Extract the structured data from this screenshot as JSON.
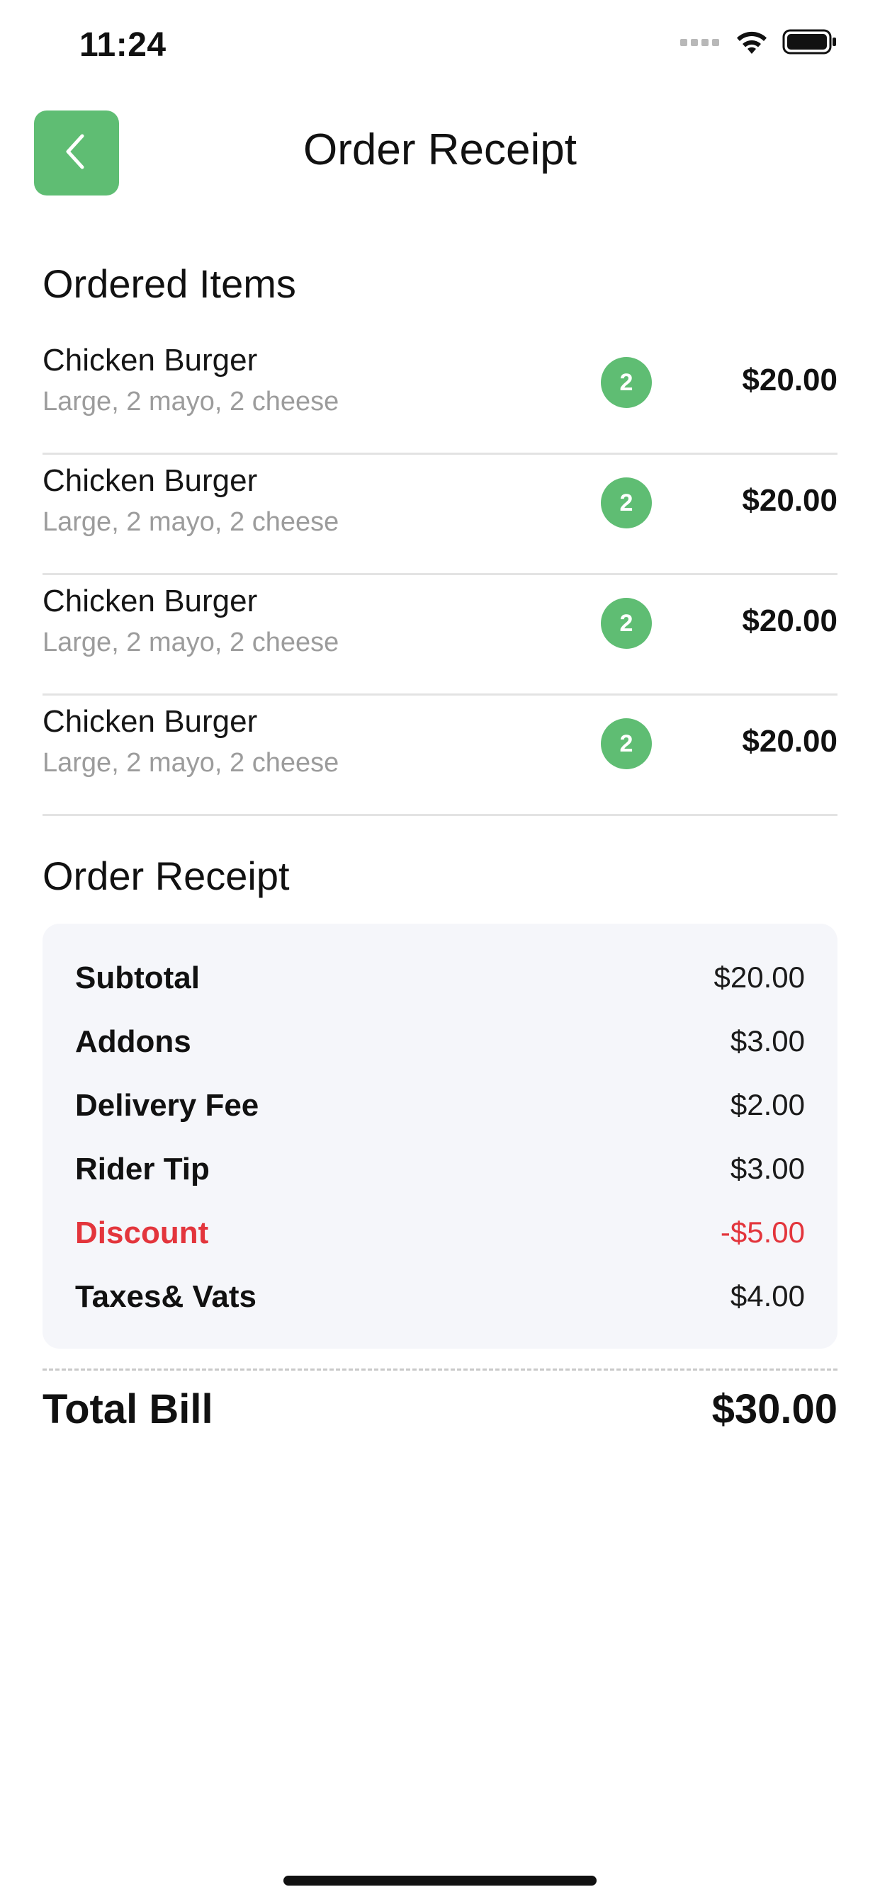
{
  "status_bar": {
    "time": "11:24",
    "icons": [
      "signal-dots-icon",
      "wifi-icon",
      "battery-icon"
    ]
  },
  "header": {
    "back_icon": "chevron-left-icon",
    "title": "Order Receipt"
  },
  "ordered_items": {
    "title": "Ordered Items",
    "items": [
      {
        "name": "Chicken Burger",
        "description": "Large, 2 mayo, 2 cheese",
        "quantity": "2",
        "price": "$20.00"
      },
      {
        "name": "Chicken Burger",
        "description": "Large, 2 mayo, 2 cheese",
        "quantity": "2",
        "price": "$20.00"
      },
      {
        "name": "Chicken Burger",
        "description": "Large, 2 mayo, 2 cheese",
        "quantity": "2",
        "price": "$20.00"
      },
      {
        "name": "Chicken Burger",
        "description": "Large, 2 mayo, 2 cheese",
        "quantity": "2",
        "price": "$20.00"
      }
    ]
  },
  "receipt": {
    "title": "Order Receipt",
    "rows": [
      {
        "label": "Subtotal",
        "value": "$20.00"
      },
      {
        "label": "Addons",
        "value": "$3.00"
      },
      {
        "label": "Delivery Fee",
        "value": "$2.00"
      },
      {
        "label": "Rider Tip",
        "value": "$3.00"
      },
      {
        "label": "Discount",
        "value": "-$5.00"
      },
      {
        "label": "Taxes& Vats",
        "value": "$4.00"
      }
    ]
  },
  "total": {
    "label": "Total Bill",
    "value": "$30.00"
  },
  "colors": {
    "accent": "#5fbd73",
    "discount": "#e3353c",
    "card_background": "#f5f6fa"
  }
}
